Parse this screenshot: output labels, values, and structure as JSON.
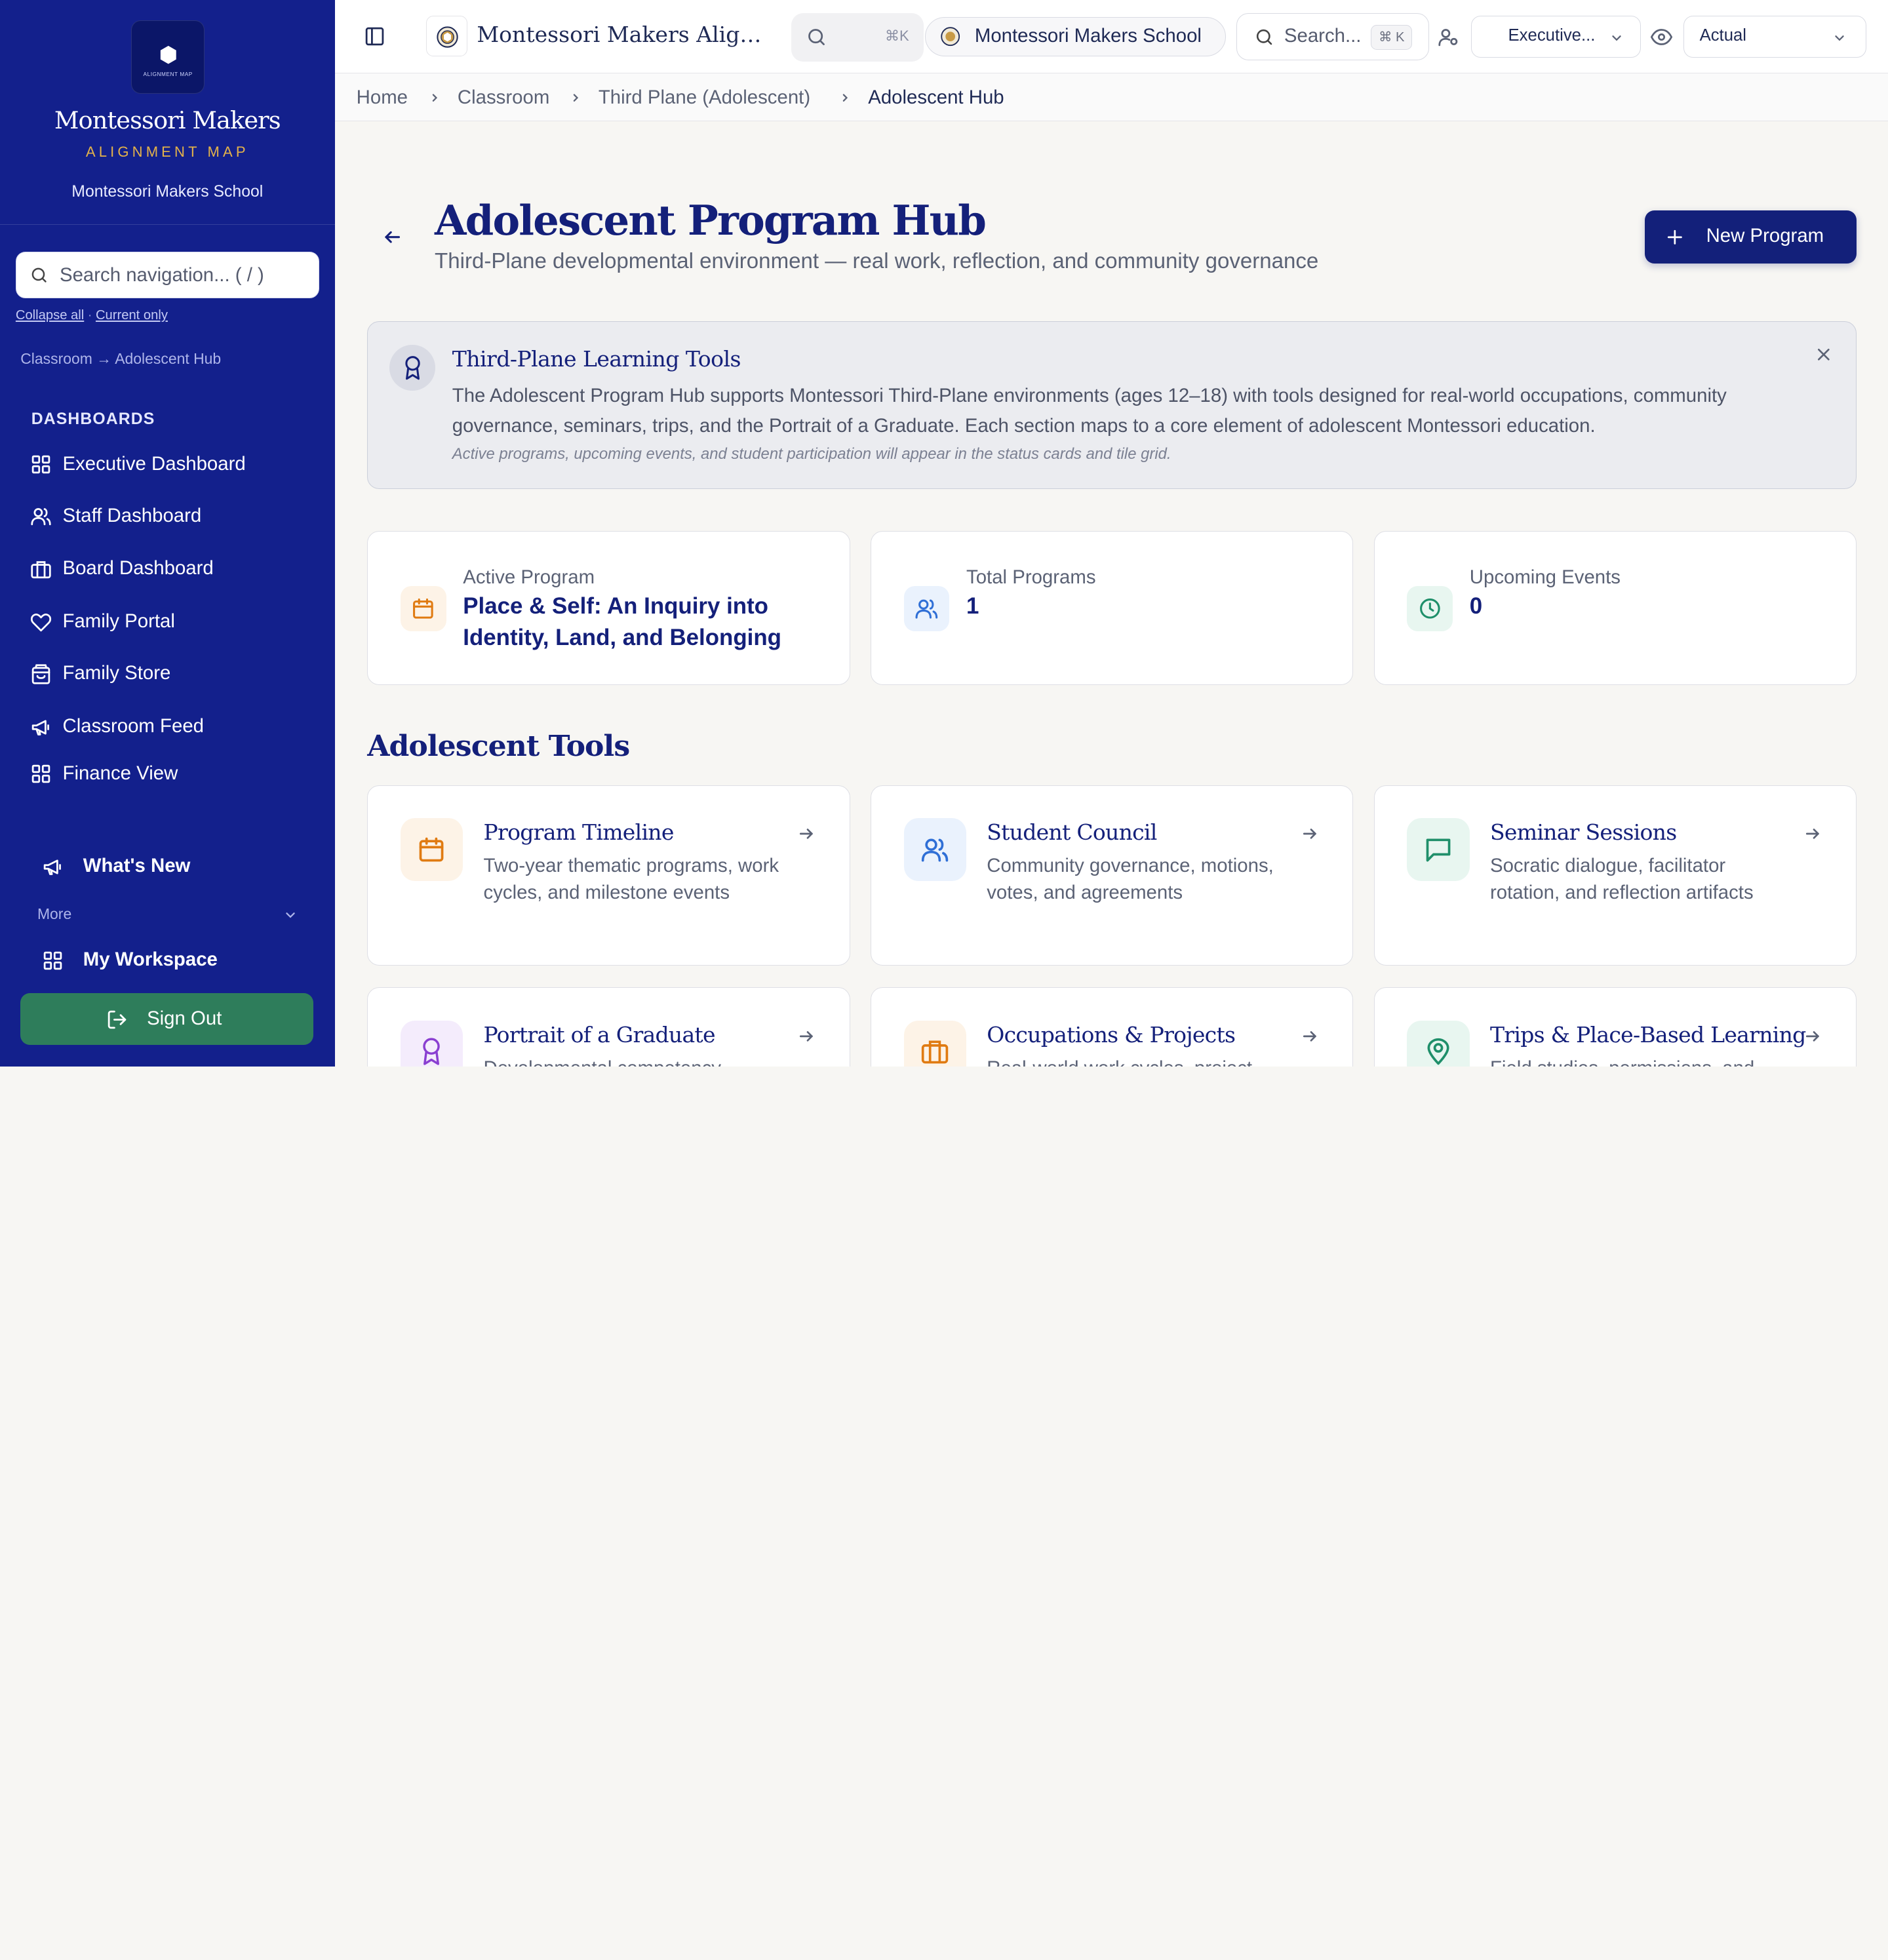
{
  "sidebar": {
    "logo_tiny": "ALIGNMENT MAP",
    "brand_name": "Montessori Makers",
    "brand_sub": "ALIGNMENT MAP",
    "school": "Montessori Makers School",
    "search_placeholder": "Search navigation... ( / )",
    "collapse_all": "Collapse all",
    "current_only": "Current only",
    "crumb": "Classroom → Adolescent Hub",
    "section_title": "DASHBOARDS",
    "items": [
      {
        "label": "Executive Dashboard",
        "icon": "grid-icon"
      },
      {
        "label": "Staff Dashboard",
        "icon": "users-icon"
      },
      {
        "label": "Board Dashboard",
        "icon": "briefcase-icon"
      },
      {
        "label": "Family Portal",
        "icon": "heart-icon"
      },
      {
        "label": "Family Store",
        "icon": "shopping-bag-icon"
      },
      {
        "label": "Classroom Feed",
        "icon": "megaphone-icon"
      },
      {
        "label": "Finance View",
        "icon": "grid-icon"
      }
    ],
    "whats_new": "What's New",
    "more": "More",
    "my_workspace": "My Workspace",
    "sign_out": "Sign Out"
  },
  "topbar": {
    "app_title": "Montessori Makers Alignment Map",
    "cmdk_hint": "⌘K",
    "school_pill": "Montessori Makers School",
    "search_label": "Search...",
    "search_kbd": "⌘ K",
    "role": "Executive...",
    "view": "Actual"
  },
  "breadcrumb": [
    "Home",
    "Classroom",
    "Third Plane (Adolescent)",
    "Adolescent Hub"
  ],
  "header": {
    "title": "Adolescent Program Hub",
    "subtitle": "Third-Plane developmental environment — real work, reflection, and community governance",
    "new_button": "New Program"
  },
  "banner": {
    "title": "Third-Plane Learning Tools",
    "text": "The Adolescent Program Hub supports Montessori Third-Plane environments (ages 12–18) with tools designed for real-world occupations, community governance, seminars, trips, and the Portrait of a Graduate. Each section maps to a core element of adolescent Montessori education.",
    "note": "Active programs, upcoming events, and student participation will appear in the status cards and tile grid."
  },
  "stats": [
    {
      "label": "Active Program",
      "value": "Place & Self: An Inquiry into Identity, Land, and Belonging",
      "icon": "calendar-icon",
      "color": "#e07b12"
    },
    {
      "label": "Total Programs",
      "value": "1",
      "icon": "users-icon",
      "color": "#2f6fd6"
    },
    {
      "label": "Upcoming Events",
      "value": "0",
      "icon": "clock-icon",
      "color": "#1f8f6a"
    }
  ],
  "tools_title": "Adolescent Tools",
  "tools": [
    {
      "title": "Program Timeline",
      "desc": "Two-year thematic programs, work cycles, and milestone events",
      "icon": "calendar-icon",
      "color": "#e07b12"
    },
    {
      "title": "Student Council",
      "desc": "Community governance, motions, votes, and agreements",
      "icon": "users-icon",
      "color": "#2f6fd6"
    },
    {
      "title": "Seminar Sessions",
      "desc": "Socratic dialogue, facilitator rotation, and reflection artifacts",
      "icon": "message-square-icon",
      "color": "#1f8f6a"
    },
    {
      "title": "Portrait of a Graduate",
      "desc": "Developmental competency",
      "icon": "award-icon",
      "color": "#8a3fd1"
    },
    {
      "title": "Occupations & Projects",
      "desc": "Real-world work cycles, project",
      "icon": "briefcase-icon",
      "color": "#e07b12"
    },
    {
      "title": "Trips & Place-Based Learning",
      "desc": "Field studies, permissions, and",
      "icon": "map-pin-icon",
      "color": "#1f8f6a"
    }
  ]
}
